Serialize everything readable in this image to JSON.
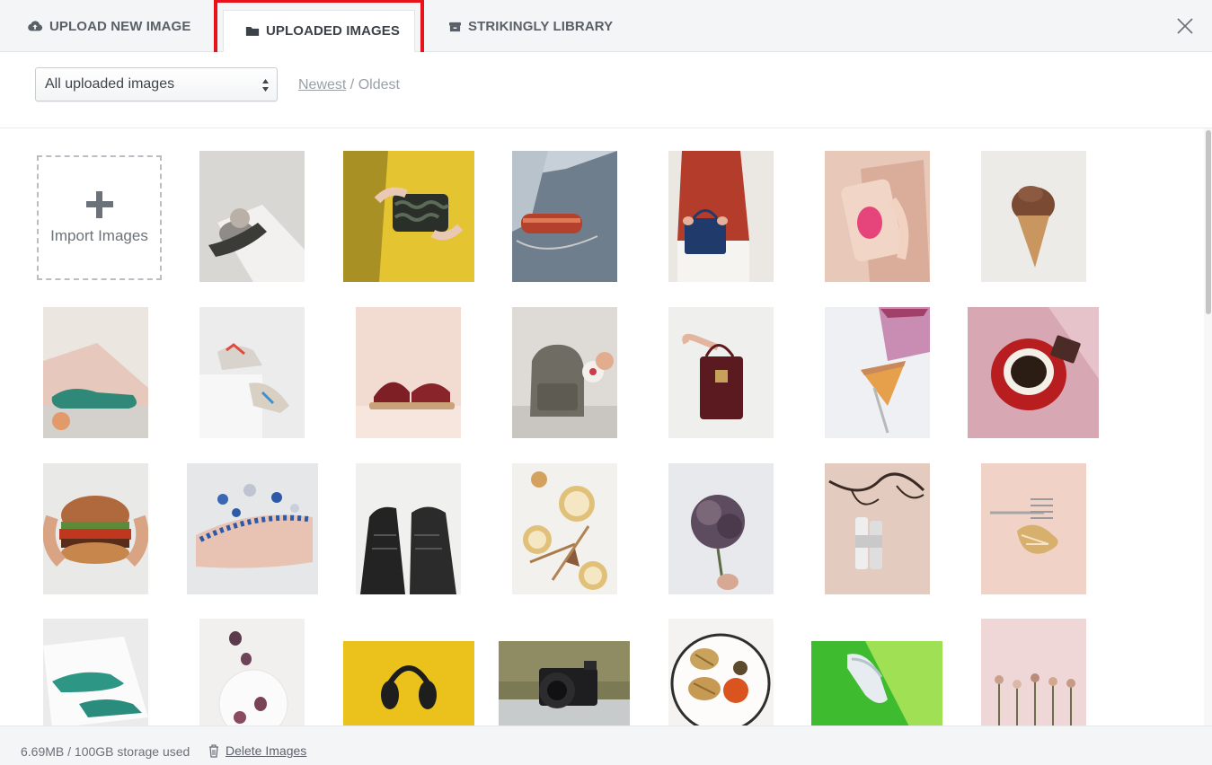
{
  "tabs": {
    "upload": {
      "label": "UPLOAD NEW IMAGE",
      "icon": "cloud-upload-icon"
    },
    "uploaded": {
      "label": "UPLOADED IMAGES",
      "icon": "folder-icon",
      "active": true
    },
    "library": {
      "label": "STRIKINGLY LIBRARY",
      "icon": "archive-box-icon"
    },
    "close_icon": "close-icon"
  },
  "filter": {
    "selected": "All uploaded images",
    "sort_newest": "Newest",
    "sort_separator": " / ",
    "sort_oldest": "Oldest"
  },
  "import_tile": {
    "label": "Import Images",
    "icon": "plus-icon"
  },
  "images": [
    {
      "subject": "flower heeled mule shoe"
    },
    {
      "subject": "hands holding black clutch on yellow"
    },
    {
      "subject": "red clutch bag with chain"
    },
    {
      "subject": "woman holding navy handbag"
    },
    {
      "subject": "pink flamingo phone case"
    },
    {
      "subject": "chocolate ice cream cone"
    },
    {
      "subject": "teal leather shoe with peach"
    },
    {
      "subject": "colorful sneakers on pedestal"
    },
    {
      "subject": "burgundy sandals on platform"
    },
    {
      "subject": "grey backpack"
    },
    {
      "subject": "burgundy croc handbag"
    },
    {
      "subject": "berry tart slices"
    },
    {
      "subject": "red coffee cup top view"
    },
    {
      "subject": "hands holding burger"
    },
    {
      "subject": "jeweled tiara in hand"
    },
    {
      "subject": "black leather boots"
    },
    {
      "subject": "cosmetic jars and spoons"
    },
    {
      "subject": "dark carnation flower"
    },
    {
      "subject": "skincare bottles with branches"
    },
    {
      "subject": "fork with gold hair clip"
    },
    {
      "subject": "teal shoes on white tray"
    },
    {
      "subject": "figs on white plate"
    },
    {
      "subject": "black headphones on yellow"
    },
    {
      "subject": "camera on wooden table"
    },
    {
      "subject": "hasselback potatoes plate"
    },
    {
      "subject": "white sneaker on green"
    },
    {
      "subject": "dried flowers on pink"
    }
  ],
  "footer": {
    "storage": "6.69MB / 100GB storage used",
    "delete_label": "Delete Images",
    "delete_icon": "trash-icon"
  },
  "colors": {
    "accent_highlight": "#e8131a",
    "tab_bar": "#f4f5f6"
  }
}
